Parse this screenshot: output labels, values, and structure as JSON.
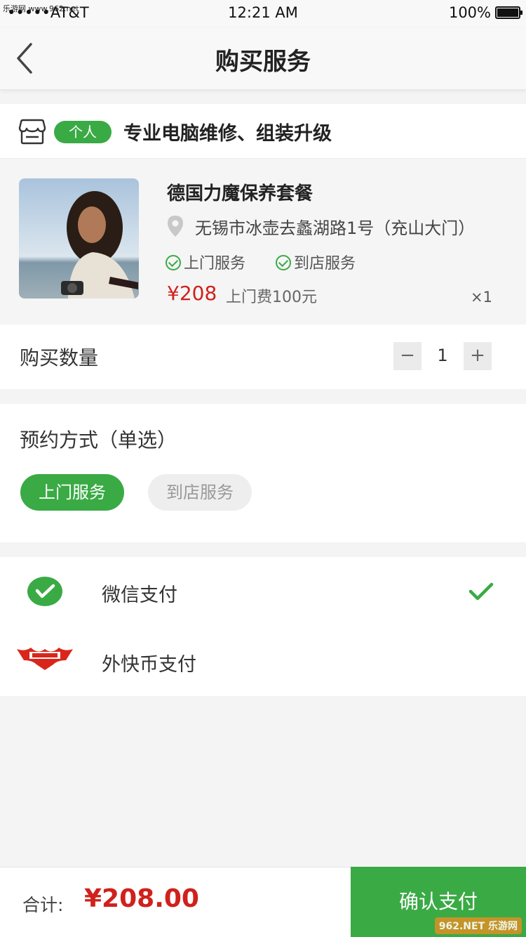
{
  "statusbar": {
    "watermark": "乐游网 www.962.net",
    "carrier": "•••••AT&T",
    "time": "12:21 AM",
    "battery": "100%"
  },
  "navbar": {
    "title": "购买服务",
    "back_icon": "chevron-left-icon"
  },
  "shop": {
    "tag": "个人",
    "name": "专业电脑维修、组装升级",
    "icon": "store-icon"
  },
  "product": {
    "name": "德国力魔保养套餐",
    "address": "无锡市冰壶去蠡湖路1号（充山大门）",
    "services": [
      "上门服务",
      "到店服务"
    ],
    "price": "¥208",
    "fee": "上门费100元",
    "quantity_badge": "×1"
  },
  "quantity": {
    "label": "购买数量",
    "minus": "−",
    "value": "1",
    "plus": "+"
  },
  "booking": {
    "label": "预约方式（单选）",
    "options": [
      {
        "label": "上门服务",
        "selected": true
      },
      {
        "label": "到店服务",
        "selected": false
      }
    ]
  },
  "payment": {
    "methods": [
      {
        "label": "微信支付",
        "icon": "wechat-pay-icon",
        "selected": true
      },
      {
        "label": "外快币支付",
        "icon": "waikuai-logo-icon",
        "selected": false
      }
    ]
  },
  "footer": {
    "total_label": "合计:",
    "total": "¥208.00",
    "confirm": "确认支付",
    "watermark": "962.NET 乐游网"
  },
  "colors": {
    "accent": "#3aaa45",
    "price": "#d0211c",
    "background": "#f4f4f4"
  }
}
